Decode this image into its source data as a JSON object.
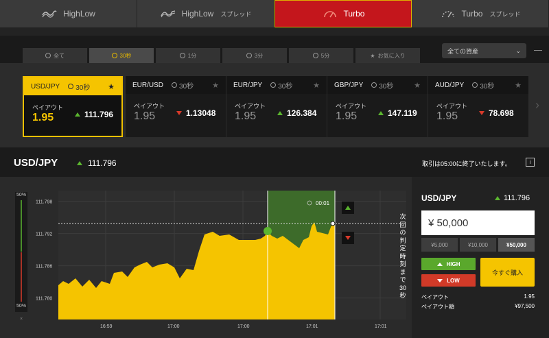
{
  "mode_tabs": [
    {
      "label": "HighLow",
      "sub": ""
    },
    {
      "label": "HighLow",
      "sub": "スプレッド"
    },
    {
      "label": "Turbo",
      "sub": ""
    },
    {
      "label": "Turbo",
      "sub": "スプレッド"
    }
  ],
  "time_tabs": [
    "全て",
    "30秒",
    "1分",
    "3分",
    "5分",
    "お気に入り"
  ],
  "asset_select": "全ての資産",
  "cards": [
    {
      "pair": "USD/JPY",
      "time": "30秒",
      "payout_label": "ペイアウト",
      "payout": "1.95",
      "price": "111.796",
      "dir": "up"
    },
    {
      "pair": "EUR/USD",
      "time": "30秒",
      "payout_label": "ペイアウト",
      "payout": "1.95",
      "price": "1.13048",
      "dir": "down"
    },
    {
      "pair": "EUR/JPY",
      "time": "30秒",
      "payout_label": "ペイアウト",
      "payout": "1.95",
      "price": "126.384",
      "dir": "up"
    },
    {
      "pair": "GBP/JPY",
      "time": "30秒",
      "payout_label": "ペイアウト",
      "payout": "1.95",
      "price": "147.119",
      "dir": "up"
    },
    {
      "pair": "AUD/JPY",
      "time": "30秒",
      "payout_label": "ペイアウト",
      "payout": "1.95",
      "price": "78.698",
      "dir": "down"
    }
  ],
  "pair_bar": {
    "name": "USD/JPY",
    "price": "111.796",
    "end_msg": "取引は05:00に終了いたします。",
    "info": "i"
  },
  "chart": {
    "y_ticks": [
      "111.798",
      "111.792",
      "111.786",
      "111.780"
    ],
    "y_values": [
      111.798,
      111.792,
      111.786,
      111.78
    ],
    "x_ticks": [
      "16:59",
      "17:00",
      "17:00",
      "17:01",
      "17:01"
    ],
    "countdown": "00:01",
    "balance_top": "50%",
    "balance_bottom": "50%",
    "balance_close": "×",
    "vertical_text": "次回の判定時刻まで30秒",
    "colors": {
      "area": "#f5c400",
      "zone": "#3d6b2a",
      "line": "#ffffff"
    }
  },
  "panel": {
    "pair": "USD/JPY",
    "price": "111.796",
    "amount": "¥ 50,000",
    "presets": [
      "¥5,000",
      "¥10,000",
      "¥50,000"
    ],
    "high": "HIGH",
    "low": "LOW",
    "buy": "今すぐ購入",
    "payout_label": "ペイアウト",
    "payout_value": "1.95",
    "payout_amount_label": "ペイアウト額",
    "payout_amount_value": "¥97,500"
  }
}
